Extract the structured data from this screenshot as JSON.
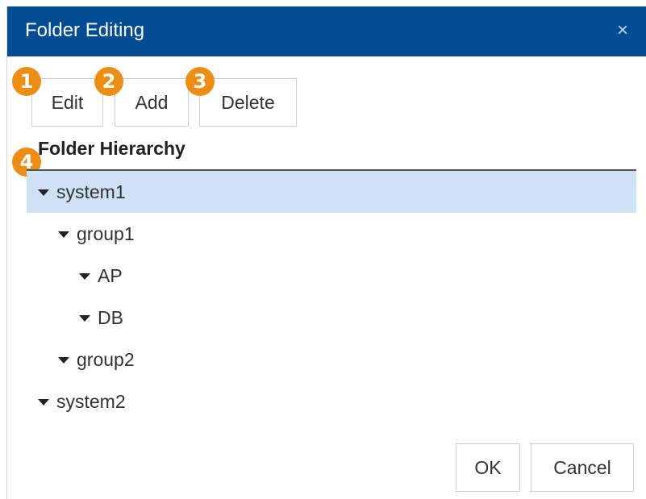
{
  "dialog": {
    "title": "Folder Editing",
    "close_glyph": "×"
  },
  "toolbar": {
    "edit_label": "Edit",
    "add_label": "Add",
    "delete_label": "Delete"
  },
  "badges": [
    "1",
    "2",
    "3",
    "4"
  ],
  "section": {
    "title": "Folder Hierarchy"
  },
  "tree": [
    {
      "label": "system1",
      "level": 0,
      "expanded": true,
      "selected": true
    },
    {
      "label": "group1",
      "level": 1,
      "expanded": true,
      "selected": false
    },
    {
      "label": "AP",
      "level": 2,
      "expanded": true,
      "selected": false
    },
    {
      "label": "DB",
      "level": 2,
      "expanded": true,
      "selected": false
    },
    {
      "label": "group2",
      "level": 1,
      "expanded": true,
      "selected": false
    },
    {
      "label": "system2",
      "level": 0,
      "expanded": true,
      "selected": false
    }
  ],
  "footer": {
    "ok_label": "OK",
    "cancel_label": "Cancel"
  },
  "colors": {
    "titlebar": "#014c93",
    "badge": "#ec8d16",
    "selected_row": "#cfe2f5"
  },
  "icons": {
    "close": "close-icon",
    "tree_toggle": "caret-down-icon"
  }
}
